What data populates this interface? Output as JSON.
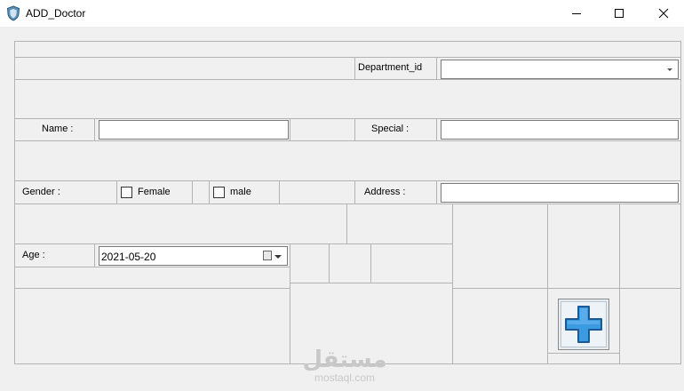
{
  "window": {
    "title": "ADD_Doctor",
    "icon": "shield-app-icon",
    "controls": [
      "minimize-icon",
      "maximize-icon",
      "close-icon"
    ]
  },
  "form": {
    "department_label": "Department_id",
    "department_value": "",
    "name_label": "Name :",
    "name_value": "",
    "special_label": "Special :",
    "special_value": "",
    "gender_label": "Gender :",
    "female_label": "Female",
    "female_checked": false,
    "male_label": "male",
    "male_checked": false,
    "address_label": "Address :",
    "address_value": "",
    "age_label": "Age :",
    "age_value": "2021-05-20",
    "add_button_icon": "plus-icon"
  },
  "watermark": {
    "arabic": "مستقل",
    "latin": "mostaql.com"
  },
  "colors": {
    "background": "#f0f0f0",
    "grid_border": "#b4b4b4",
    "plus_fill": "#3c9be0",
    "plus_stroke": "#1c5a94"
  }
}
